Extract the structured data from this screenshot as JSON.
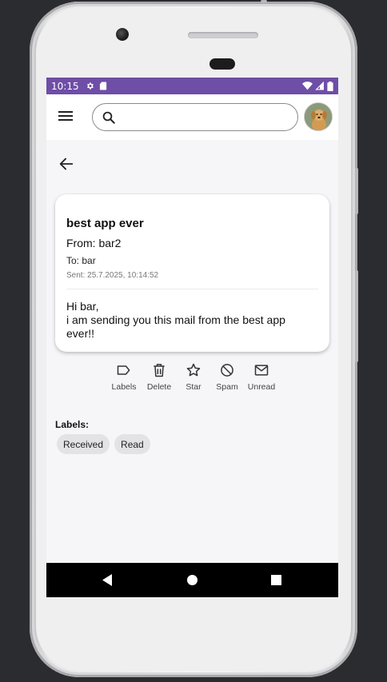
{
  "status": {
    "time": "10:15",
    "left_icons": [
      "gear-icon",
      "sim-card-icon"
    ],
    "right_icons": [
      "wifi-icon",
      "signal-icon",
      "battery-icon"
    ],
    "bar_color": "#6e4ea6"
  },
  "appbar": {
    "menu_icon": "hamburger-menu-icon",
    "search_placeholder": "",
    "search_icon": "search-icon",
    "avatar": "user-avatar-dog"
  },
  "mail": {
    "subject": "best app ever",
    "from": "From: bar2",
    "to": "To: bar",
    "sent": "Sent: 25.7.2025, 10:14:52",
    "body": "Hi bar,\ni am sending you this mail from the best app ever!!"
  },
  "actions": [
    {
      "label": "Labels",
      "icon": "label-icon"
    },
    {
      "label": "Delete",
      "icon": "trash-icon"
    },
    {
      "label": "Star",
      "icon": "star-icon"
    },
    {
      "label": "Spam",
      "icon": "block-icon"
    },
    {
      "label": "Unread",
      "icon": "mail-icon"
    }
  ],
  "labels": {
    "title": "Labels:",
    "chips": [
      "Received",
      "Read"
    ]
  }
}
